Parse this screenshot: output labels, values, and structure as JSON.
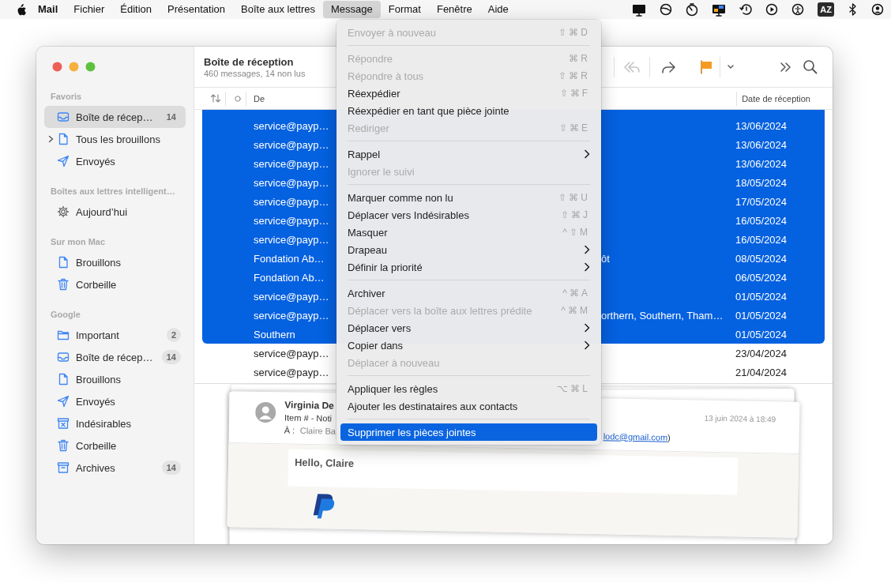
{
  "menubar": {
    "app": "Mail",
    "status_text": "AZ",
    "menus": [
      {
        "label": "Fichier",
        "selected": false
      },
      {
        "label": "Édition",
        "selected": false
      },
      {
        "label": "Présentation",
        "selected": false
      },
      {
        "label": "Boîte aux lettres",
        "selected": false
      },
      {
        "label": "Message",
        "selected": true
      },
      {
        "label": "Format",
        "selected": false
      },
      {
        "label": "Fenêtre",
        "selected": false
      },
      {
        "label": "Aide",
        "selected": false
      }
    ]
  },
  "sidebar": {
    "sections": [
      {
        "title": "Favoris",
        "items": [
          {
            "label": "Boîte de récep…",
            "kind": "inbox",
            "badge": "14",
            "selected": true
          },
          {
            "label": "Tous les brouillons",
            "kind": "drafts",
            "expanded": false,
            "selected": false
          },
          {
            "label": "Envoyés",
            "kind": "sent",
            "selected": false
          }
        ]
      },
      {
        "title": "Boîtes aux lettres intelligent…",
        "items": [
          {
            "label": "Aujourd’hui",
            "kind": "smart",
            "selected": false
          }
        ]
      },
      {
        "title": "Sur mon Mac",
        "items": [
          {
            "label": "Brouillons",
            "kind": "drafts",
            "selected": false
          },
          {
            "label": "Corbeille",
            "kind": "trash",
            "selected": false
          }
        ]
      },
      {
        "title": "Google",
        "items": [
          {
            "label": "Important",
            "kind": "folder",
            "badge": "2",
            "selected": false
          },
          {
            "label": "Boîte de récep…",
            "kind": "inbox",
            "badge": "14",
            "selected": false
          },
          {
            "label": "Brouillons",
            "kind": "drafts",
            "selected": false
          },
          {
            "label": "Envoyés",
            "kind": "sent",
            "selected": false
          },
          {
            "label": "Indésirables",
            "kind": "junk",
            "selected": false
          },
          {
            "label": "Corbeille",
            "kind": "trash",
            "selected": false
          },
          {
            "label": "Archives",
            "kind": "archive",
            "badge": "14",
            "selected": false
          }
        ]
      }
    ]
  },
  "mailbox": {
    "title": "Boîte de réception",
    "subtitle": "460 messages, 14 non lus"
  },
  "message_list": {
    "columns": [
      "De",
      "Date de réception"
    ],
    "rows": [
      {
        "from": "service@payp…",
        "date": "13/06/2024",
        "selected": true
      },
      {
        "from": "service@payp…",
        "date": "13/06/2024",
        "selected": true
      },
      {
        "from": "service@payp…",
        "date": "13/06/2024",
        "selected": true
      },
      {
        "from": "service@payp…",
        "date": "18/05/2024",
        "selected": true
      },
      {
        "from": "service@payp…",
        "date": "17/05/2024",
        "selected": true
      },
      {
        "from": "service@payp…",
        "date": "16/05/2024",
        "selected": true
      },
      {
        "from": "service@payp…",
        "date": "16/05/2024",
        "selected": true
      },
      {
        "from": "Fondation Ab…",
        "subject": "ôt",
        "date": "08/05/2024",
        "selected": true
      },
      {
        "from": "Fondation Ab…",
        "date": "06/05/2024",
        "selected": true
      },
      {
        "from": "service@payp…",
        "date": "01/05/2024",
        "selected": true
      },
      {
        "from": "service@payp…",
        "subject": "orthern, Southern, Tham…",
        "date": "01/05/2024",
        "selected": true
      },
      {
        "from": "Southern",
        "date": "01/05/2024",
        "selected": true
      },
      {
        "from": "service@payp…",
        "date": "23/04/2024",
        "selected": false
      },
      {
        "from": "service@payp…",
        "date": "21/04/2024",
        "selected": false
      }
    ]
  },
  "menu": {
    "items": [
      {
        "kind": "item",
        "label": "Envoyer à nouveau",
        "shortcut": "⇧⌘D",
        "disabled": true,
        "selected": false
      },
      {
        "kind": "separator"
      },
      {
        "kind": "item",
        "label": "Répondre",
        "shortcut": "⌘R",
        "disabled": true,
        "selected": false
      },
      {
        "kind": "item",
        "label": "Répondre à tous",
        "shortcut": "⇧⌘R",
        "disabled": true,
        "selected": false
      },
      {
        "kind": "item",
        "label": "Réexpédier",
        "shortcut": "⇧⌘F",
        "disabled": false,
        "selected": false
      },
      {
        "kind": "item",
        "label": "Réexpédier en tant que pièce jointe",
        "disabled": false,
        "selected": false
      },
      {
        "kind": "item",
        "label": "Rediriger",
        "shortcut": "⇧⌘E",
        "disabled": true,
        "selected": false
      },
      {
        "kind": "separator"
      },
      {
        "kind": "item",
        "label": "Rappel",
        "submenu": true,
        "disabled": false,
        "selected": false
      },
      {
        "kind": "item",
        "label": "Ignorer le suivi",
        "disabled": true,
        "selected": false
      },
      {
        "kind": "separator"
      },
      {
        "kind": "item",
        "label": "Marquer comme non lu",
        "shortcut": "⇧⌘U",
        "disabled": false,
        "selected": false
      },
      {
        "kind": "item",
        "label": "Déplacer vers Indésirables",
        "shortcut": "⇧⌘J",
        "disabled": false,
        "selected": false
      },
      {
        "kind": "item",
        "label": "Masquer",
        "shortcut": "^⇧M",
        "disabled": false,
        "selected": false
      },
      {
        "kind": "item",
        "label": "Drapeau",
        "submenu": true,
        "disabled": false,
        "selected": false
      },
      {
        "kind": "item",
        "label": "Définir la priorité",
        "submenu": true,
        "disabled": false,
        "selected": false
      },
      {
        "kind": "separator"
      },
      {
        "kind": "item",
        "label": "Archiver",
        "shortcut": "^⌘A",
        "disabled": false,
        "selected": false
      },
      {
        "kind": "item",
        "label": "Déplacer vers la boîte aux lettres prédite",
        "shortcut": "^⌘M",
        "disabled": true,
        "selected": false
      },
      {
        "kind": "item",
        "label": "Déplacer vers",
        "submenu": true,
        "disabled": false,
        "selected": false
      },
      {
        "kind": "item",
        "label": "Copier dans",
        "submenu": true,
        "disabled": false,
        "selected": false
      },
      {
        "kind": "item",
        "label": "Déplacer à nouveau",
        "disabled": true,
        "selected": false
      },
      {
        "kind": "separator"
      },
      {
        "kind": "item",
        "label": "Appliquer les règles",
        "shortcut": "⌥⌘L",
        "disabled": false,
        "selected": false
      },
      {
        "kind": "item",
        "label": "Ajouter les destinataires aux contacts",
        "disabled": false,
        "selected": false
      },
      {
        "kind": "separator"
      },
      {
        "kind": "item",
        "label": "Supprimer les pièces jointes",
        "disabled": false,
        "selected": true
      }
    ]
  },
  "preview": {
    "sender": "Virginia De",
    "subject": "Item # - Noti",
    "to_label": "À :",
    "to": "Claire Ba",
    "email_link": "lodc@gmail.com",
    "email_suffix": ")",
    "date": "13 juin 2024 à 18:49",
    "greeting": "Hello, Claire"
  }
}
